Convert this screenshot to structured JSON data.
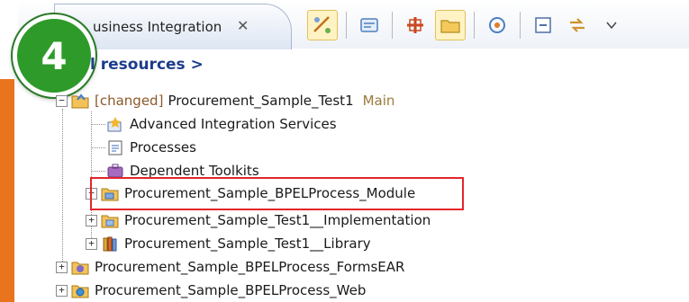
{
  "view": {
    "tab_title": "usiness Integration",
    "close_glyph": "✕",
    "step_badge": "4",
    "breadcrumb": "l resources >"
  },
  "toolbar": {
    "buttons": [
      "link-editor-icon",
      "show-all-icon",
      "filter-icon",
      "folder-icon",
      "sync-icon",
      "collapse-all-icon",
      "link-with-editor-icon",
      "view-menu-icon"
    ]
  },
  "tree": {
    "root": {
      "changed_label": "[changed]",
      "label": "Procurement_Sample_Test1",
      "tag": "Main",
      "children": [
        "Advanced Integration Services",
        "Processes",
        "Dependent Toolkits",
        "Procurement_Sample_BPELProcess_Module",
        "Procurement_Sample_Test1__Implementation",
        "Procurement_Sample_Test1__Library"
      ]
    },
    "projects": [
      "Procurement_Sample_BPELProcess_FormsEAR",
      "Procurement_Sample_BPELProcess_Web"
    ]
  },
  "colors": {
    "badge": "#2e9a2a",
    "highlight": "#e3262b",
    "side_bar": "#e8741e"
  }
}
